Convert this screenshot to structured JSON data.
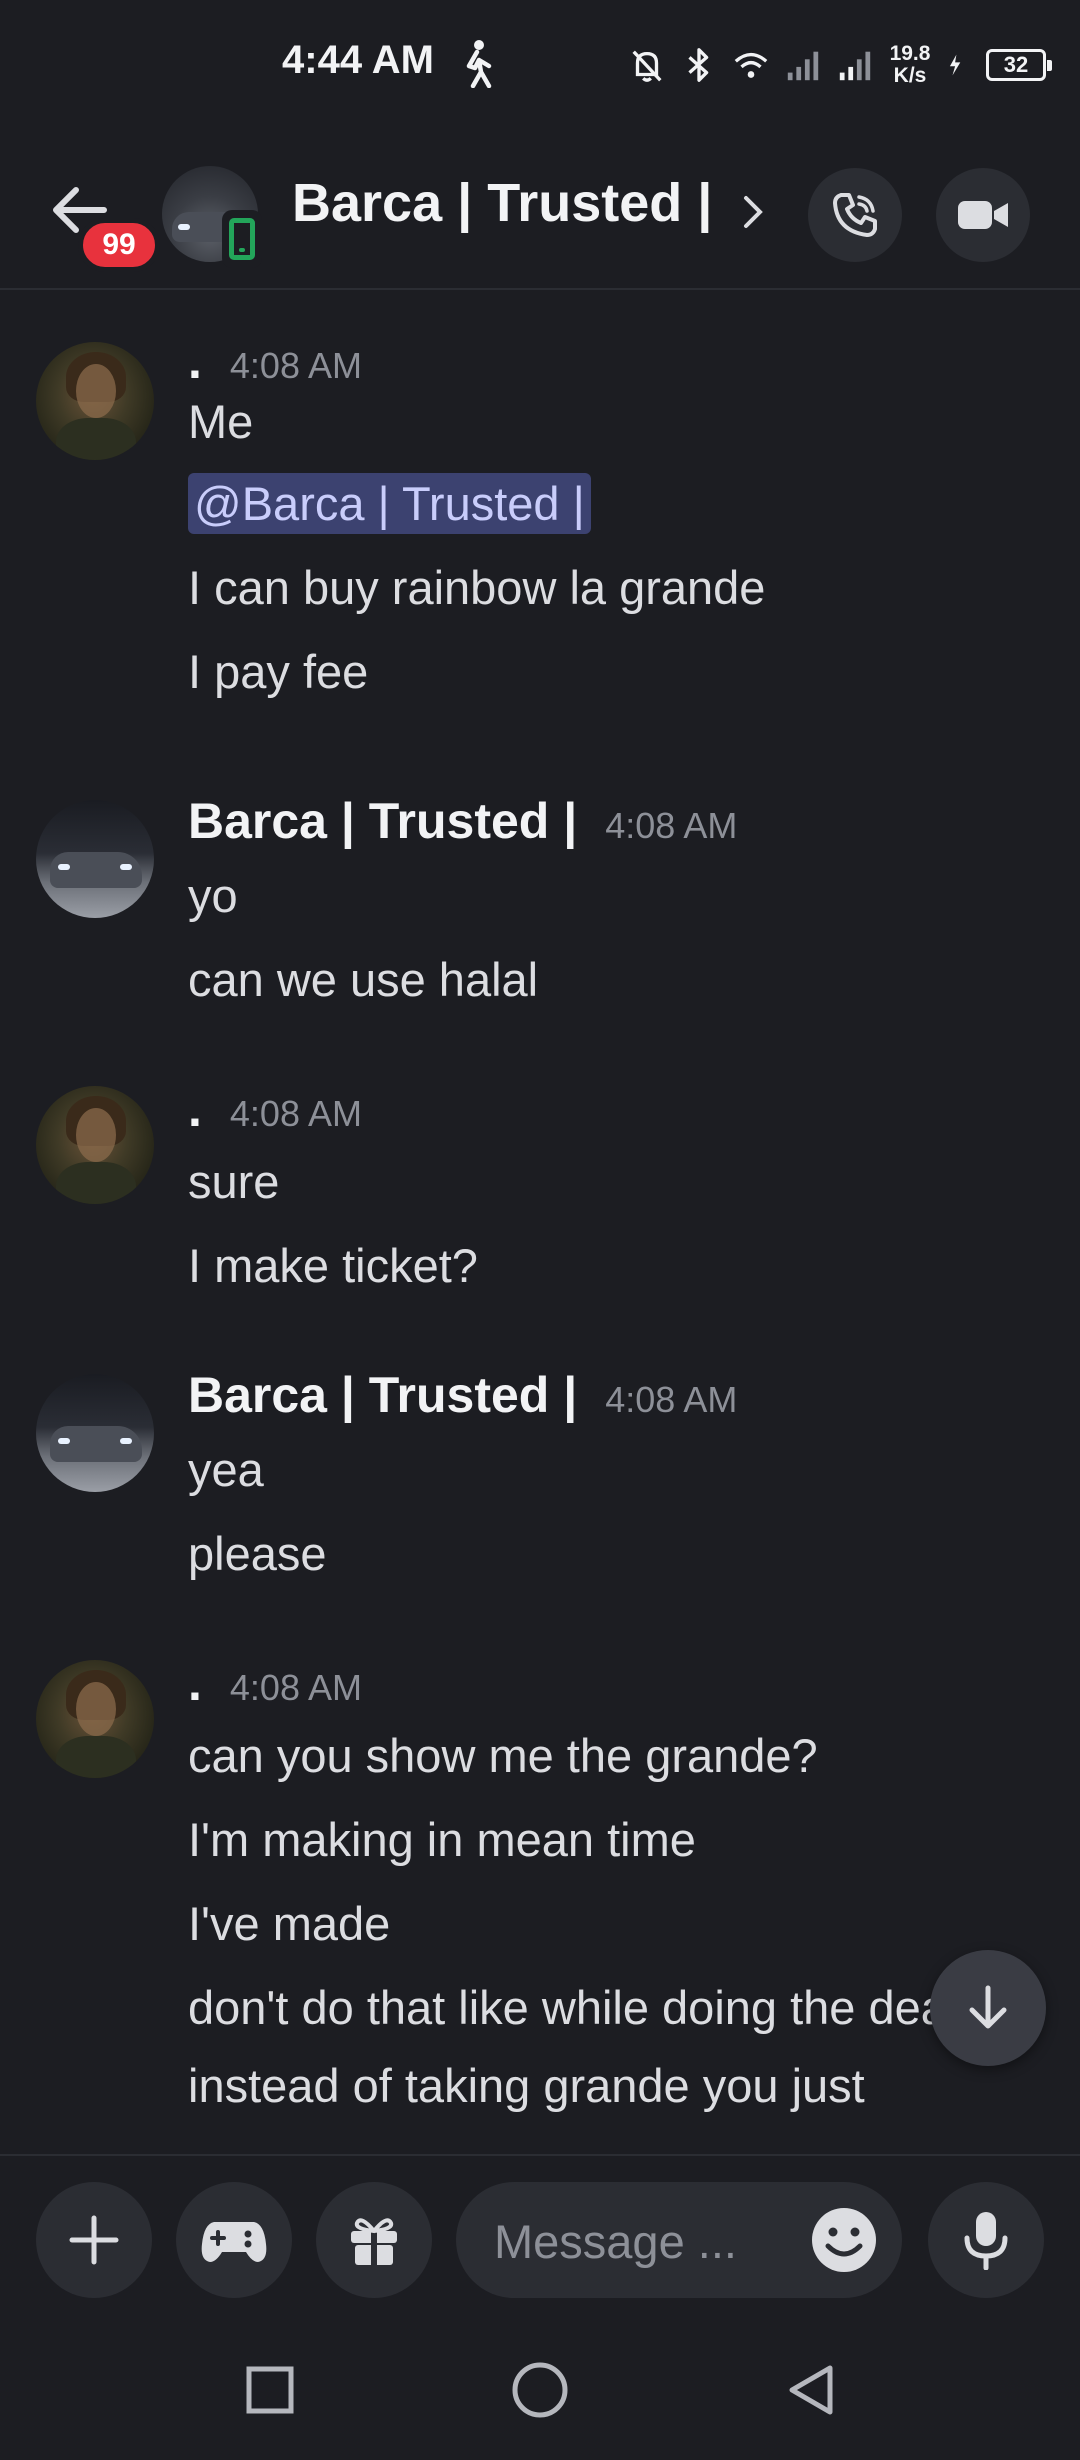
{
  "status_bar": {
    "time": "4:44 AM",
    "net_speed_value": "19.8",
    "net_speed_unit": "K/s",
    "battery": "32",
    "icons": [
      "walking-icon",
      "bell-muted-icon",
      "bluetooth-icon",
      "wifi-icon",
      "signal-icon",
      "signal-icon",
      "charging-icon"
    ]
  },
  "header": {
    "unread_badge": "99",
    "title": "Barca | Trusted |",
    "status": "mobile-online"
  },
  "messages": [
    {
      "author": ".",
      "time": "4:08 AM",
      "avatar": "woman-avatar",
      "lines": [
        "Me",
        "@Barca | Trusted |",
        "I can buy rainbow la grande",
        "I pay fee"
      ]
    },
    {
      "author": "Barca | Trusted |",
      "time": "4:08 AM",
      "avatar": "car-avatar",
      "lines": [
        "yo",
        "can we use halal"
      ]
    },
    {
      "author": ".",
      "time": "4:08 AM",
      "avatar": "woman-avatar",
      "lines": [
        "sure",
        "I make ticket?"
      ]
    },
    {
      "author": "Barca | Trusted |",
      "time": "4:08 AM",
      "avatar": "car-avatar",
      "lines": [
        "yea",
        "please"
      ]
    },
    {
      "author": ".",
      "time": "4:08 AM",
      "avatar": "woman-avatar",
      "lines": [
        "can you show me the grande?",
        "I'm making in mean time",
        "I've made",
        "don't do that like while doing the deal",
        "instead of taking grande you just"
      ]
    }
  ],
  "input": {
    "placeholder": "Message ..."
  },
  "colors": {
    "background": "#1c1d22",
    "mention_bg": "#3c4270",
    "mention_text": "#c9cdfb",
    "badge": "#e8323d",
    "online": "#23a55a"
  }
}
